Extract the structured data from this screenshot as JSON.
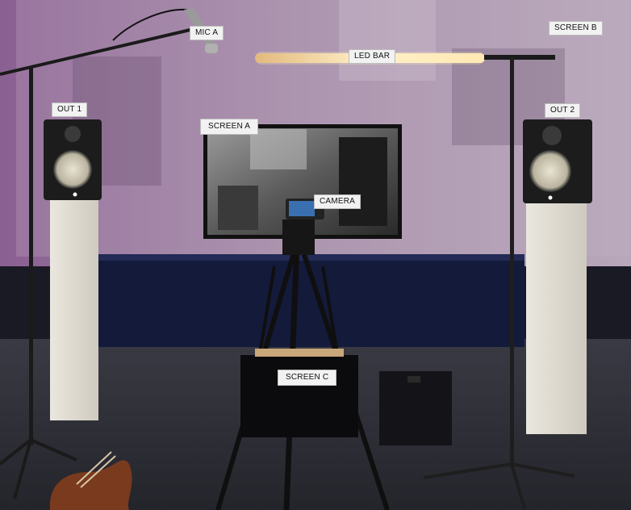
{
  "labels": {
    "mic_a": "MIC A",
    "led_bar": "LED BAR",
    "screen_b": "SCREEN B",
    "out_1": "OUT 1",
    "out_2": "OUT 2",
    "screen_a": "SCREEN A",
    "camera": "CAMERA",
    "screen_c": "SCREEN C"
  },
  "colors": {
    "projection": "#b49ab8",
    "floor": "#2a2a33",
    "platform": "#141a3a",
    "speaker_stand": "#dcd8cf",
    "led_glow": "#ffe6b0"
  }
}
